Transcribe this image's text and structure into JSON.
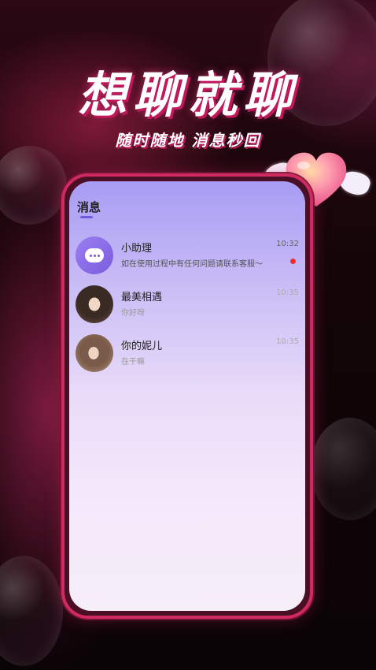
{
  "banner": {
    "title": "想聊就聊",
    "subtitle": "随时随地 消息秒回"
  },
  "colors": {
    "accent": "#d02a63",
    "primary": "#6a5be0",
    "unread": "#e8302f"
  },
  "messages": {
    "header": "消息",
    "items": [
      {
        "name": "小助理",
        "preview": "如在使用过程中有任何问题请联系客服～",
        "time": "10:32",
        "unread": true,
        "avatar_icon": "chat-bubble-icon"
      },
      {
        "name": "最美相遇",
        "preview": "你好呀",
        "time": "10:35",
        "unread": false
      },
      {
        "name": "你的妮儿",
        "preview": "在干嘛",
        "time": "10:35",
        "unread": false
      }
    ]
  }
}
